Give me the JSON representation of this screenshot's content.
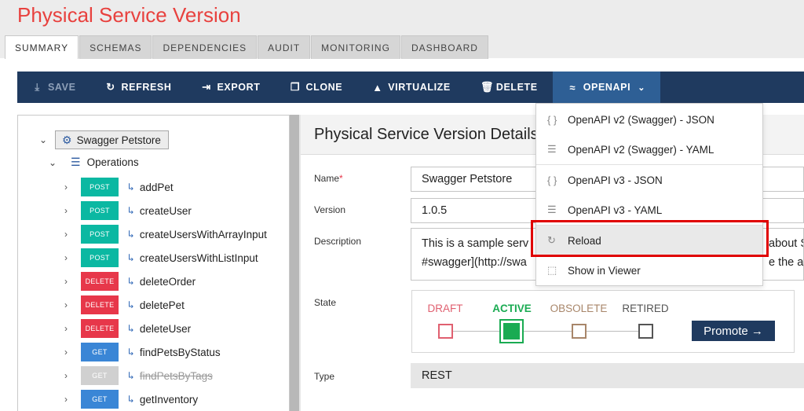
{
  "page": {
    "title": "Physical Service Version"
  },
  "tabs": [
    "SUMMARY",
    "SCHEMAS",
    "DEPENDENCIES",
    "AUDIT",
    "MONITORING",
    "DASHBOARD"
  ],
  "toolbar": {
    "save": "SAVE",
    "refresh": "REFRESH",
    "export": "EXPORT",
    "clone": "CLONE",
    "virtualize": "VIRTUALIZE",
    "delete": "DELETE",
    "openapi": "OPENAPI"
  },
  "tree": {
    "root": "Swagger Petstore",
    "operations_label": "Operations",
    "operations": [
      {
        "method": "POST",
        "name": "addPet"
      },
      {
        "method": "POST",
        "name": "createUser"
      },
      {
        "method": "POST",
        "name": "createUsersWithArrayInput"
      },
      {
        "method": "POST",
        "name": "createUsersWithListInput"
      },
      {
        "method": "DELETE",
        "name": "deleteOrder"
      },
      {
        "method": "DELETE",
        "name": "deletePet"
      },
      {
        "method": "DELETE",
        "name": "deleteUser"
      },
      {
        "method": "GET",
        "name": "findPetsByStatus"
      },
      {
        "method": "GET",
        "name": "findPetsByTags",
        "deprecated": true
      },
      {
        "method": "GET",
        "name": "getInventory"
      }
    ]
  },
  "details": {
    "title": "Physical Service Version Details",
    "name_label": "Name",
    "name_required": "*",
    "name_value": "Swagger Petstore",
    "version_label": "Version",
    "version_value": "1.0.5",
    "description_label": "Description",
    "description_line1": "This is a sample serv",
    "description_line1_end": "about S",
    "description_line2": "#swagger](http://swa",
    "description_line2_end": "e the ap",
    "state_label": "State",
    "states": [
      "DRAFT",
      "ACTIVE",
      "OBSOLETE",
      "RETIRED"
    ],
    "current_state": "ACTIVE",
    "promote_label": "Promote →",
    "type_label": "Type",
    "type_value": "REST"
  },
  "openapi_menu": {
    "items": [
      {
        "label": "OpenAPI v2 (Swagger) - JSON",
        "icon": "braces-icon"
      },
      {
        "label": "OpenAPI v2 (Swagger) - YAML",
        "icon": "lines-icon"
      },
      {
        "label": "OpenAPI v3 - JSON",
        "icon": "braces-icon"
      },
      {
        "label": "OpenAPI v3 - YAML",
        "icon": "lines-icon"
      },
      {
        "label": "Reload",
        "icon": "reload-icon"
      },
      {
        "label": "Show in Viewer",
        "icon": "viewer-icon"
      }
    ]
  },
  "colors": {
    "title_red": "#e8413e",
    "toolbar_navy": "#1f3a5f",
    "post": "#0bb8a2",
    "delete": "#e7374a",
    "get": "#3a86d6",
    "active_state": "#1aab52",
    "highlight": "#e00000"
  }
}
